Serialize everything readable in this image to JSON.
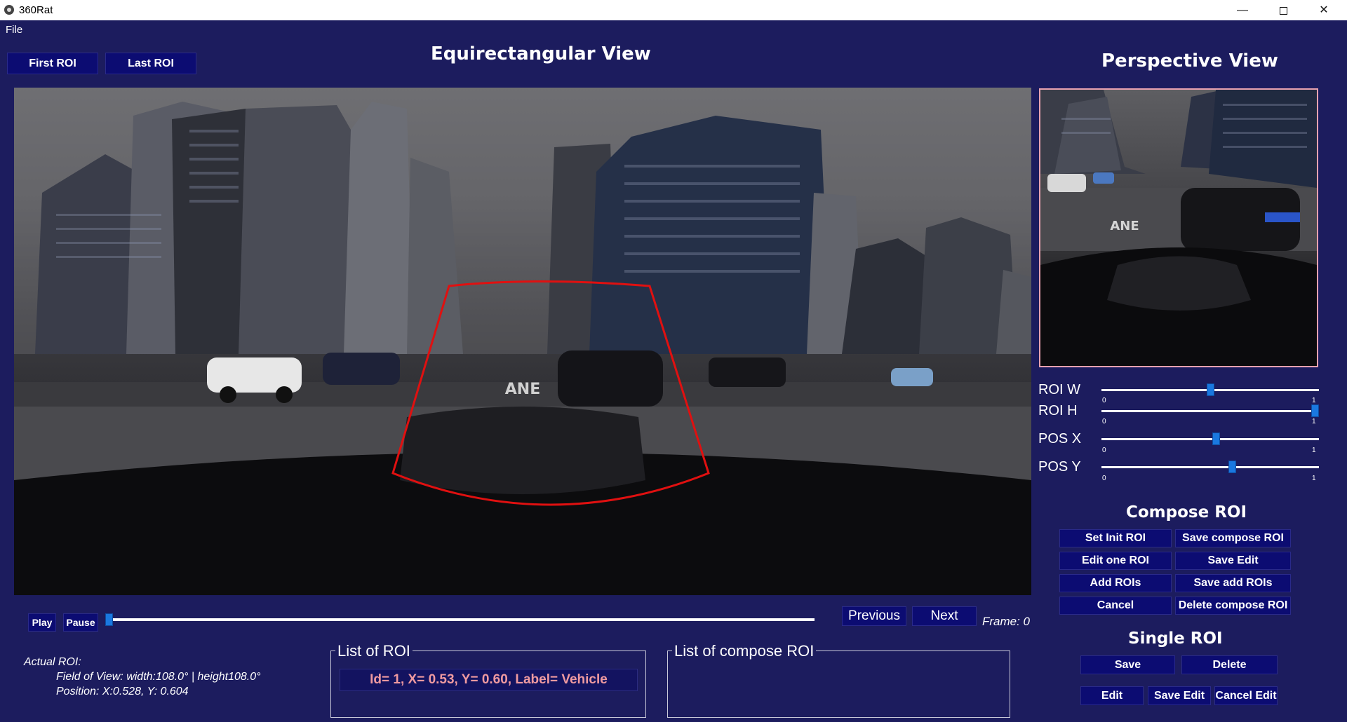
{
  "window": {
    "title": "360Rat",
    "minimize_glyph": "—",
    "close_glyph": "✕"
  },
  "menu": {
    "file": "File"
  },
  "toolbar": {
    "first_roi": "First ROI",
    "last_roi": "Last ROI"
  },
  "equirect": {
    "heading": "Equirectangular View",
    "road_marking": "ANE"
  },
  "perspective": {
    "heading": "Perspective View",
    "road_marking": "ANE"
  },
  "sliders": [
    {
      "label": "ROI W",
      "min": "0",
      "max": "1",
      "value": 0.5
    },
    {
      "label": "ROI H",
      "min": "0",
      "max": "1",
      "value": 1.0
    },
    {
      "label": "POS X",
      "min": "0",
      "max": "1",
      "value": 0.528
    },
    {
      "label": "POS Y",
      "min": "0",
      "max": "1",
      "value": 0.604
    }
  ],
  "compose": {
    "heading": "Compose ROI",
    "set_init": "Set Init ROI",
    "save_compose": "Save compose ROI",
    "edit_one": "Edit one ROI",
    "save_edit": "Save Edit",
    "add_rois": "Add ROIs",
    "save_add": "Save add ROIs",
    "cancel": "Cancel",
    "delete_compose": "Delete compose ROI"
  },
  "single": {
    "heading": "Single ROI",
    "save": "Save",
    "delete": "Delete",
    "edit": "Edit",
    "save_edit": "Save Edit",
    "cancel_edit": "Cancel Edit"
  },
  "playback": {
    "play": "Play",
    "pause": "Pause",
    "previous": "Previous",
    "next": "Next",
    "frame": "Frame: 0",
    "position": 0.0
  },
  "actual_roi": {
    "title": "Actual ROI:",
    "fov": "Field of View: width:108.0° | height108.0°",
    "position": "Position: X:0.528,  Y: 0.604"
  },
  "list_roi": {
    "title": "List of ROI",
    "items": [
      "Id= 1, X= 0.53, Y= 0.60, Label= Vehicle"
    ]
  },
  "list_compose": {
    "title": "List of compose ROI",
    "items": []
  },
  "colors": {
    "background": "#1c1c5e",
    "button": "#0c0c72",
    "roi_outline": "#e01010",
    "slider_thumb": "#1a78e0",
    "roi_item_text": "#ef9aa0",
    "perspective_border": "#e8a2b0"
  }
}
